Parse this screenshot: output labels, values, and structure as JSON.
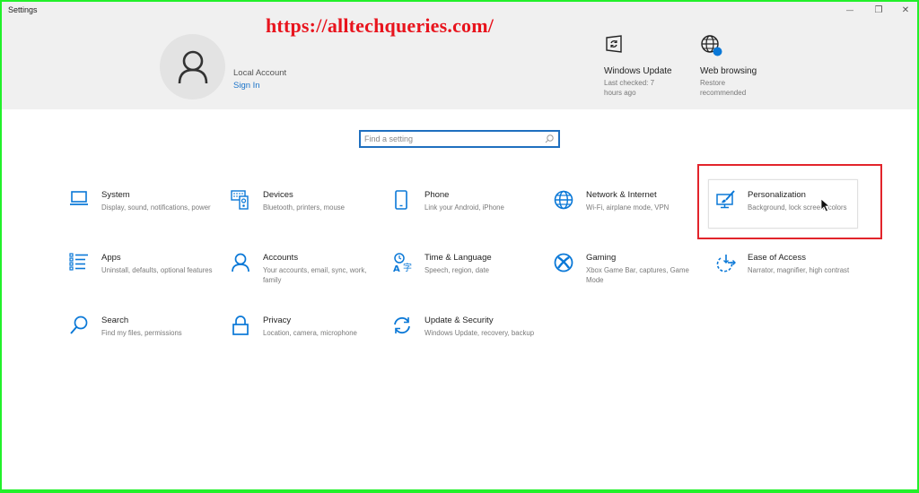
{
  "window": {
    "title": "Settings",
    "controls": {
      "minimize": "—",
      "maximize": "❐",
      "close": "✕"
    }
  },
  "watermark": "https://alltechqueries.com/",
  "account": {
    "name": "Local Account",
    "sign_in": "Sign In",
    "avatar_icon": "person-icon"
  },
  "status": [
    {
      "title": "Windows Update",
      "subtitle": "Last checked: 7 hours ago",
      "icon": "windows-update-icon"
    },
    {
      "title": "Web browsing",
      "subtitle": "Restore recommended",
      "icon": "globe-icon",
      "badge_color": "#0a78d7"
    }
  ],
  "search": {
    "placeholder": "Find a setting",
    "value": ""
  },
  "tiles": [
    {
      "title": "System",
      "desc": "Display, sound, notifications, power",
      "icon": "laptop-icon"
    },
    {
      "title": "Devices",
      "desc": "Bluetooth, printers, mouse",
      "icon": "devices-icon"
    },
    {
      "title": "Phone",
      "desc": "Link your Android, iPhone",
      "icon": "phone-icon"
    },
    {
      "title": "Network & Internet",
      "desc": "Wi-Fi, airplane mode, VPN",
      "icon": "globe-icon"
    },
    {
      "title": "Personalization",
      "desc": "Background, lock screen, colors",
      "icon": "personalization-icon",
      "highlighted": true
    },
    {
      "title": "Apps",
      "desc": "Uninstall, defaults, optional features",
      "icon": "apps-list-icon"
    },
    {
      "title": "Accounts",
      "desc": "Your accounts, email, sync, work, family",
      "icon": "person-icon"
    },
    {
      "title": "Time & Language",
      "desc": "Speech, region, date",
      "icon": "time-language-icon"
    },
    {
      "title": "Gaming",
      "desc": "Xbox Game Bar, captures, Game Mode",
      "icon": "xbox-icon"
    },
    {
      "title": "Ease of Access",
      "desc": "Narrator, magnifier, high contrast",
      "icon": "ease-of-access-icon"
    },
    {
      "title": "Search",
      "desc": "Find my files, permissions",
      "icon": "search-icon"
    },
    {
      "title": "Privacy",
      "desc": "Location, camera, microphone",
      "icon": "lock-icon"
    },
    {
      "title": "Update & Security",
      "desc": "Windows Update, recovery, backup",
      "icon": "sync-icon"
    }
  ],
  "colors": {
    "accent": "#0a78d7",
    "highlight_box": "#e2242b",
    "frame": "#22f02a",
    "watermark": "#e8141d"
  }
}
